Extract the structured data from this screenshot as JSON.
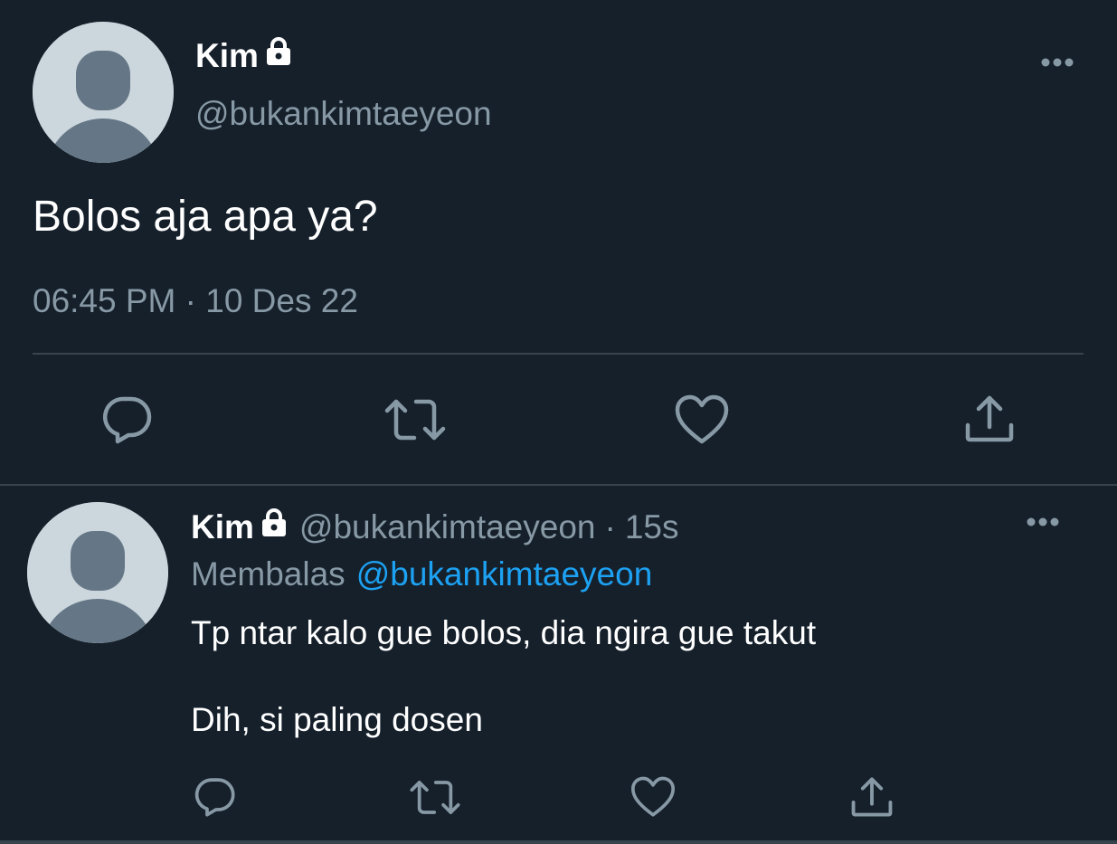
{
  "main_tweet": {
    "author_name": "Kim",
    "author_handle": "@bukankimtaeyeon",
    "text": "Bolos aja apa ya?",
    "meta": "06:45 PM · 10 Des 22",
    "protected_icon": "lock-icon",
    "more_icon": "more-horizontal-icon",
    "actions": [
      "reply-icon",
      "retweet-icon",
      "like-icon",
      "share-icon"
    ]
  },
  "reply_tweet": {
    "author_name": "Kim",
    "author_handle": "@bukankimtaeyeon",
    "separator": "·",
    "time": "15s",
    "replying_label": "Membalas",
    "replying_to": "@bukankimtaeyeon",
    "lines": [
      "Tp ntar kalo gue bolos, dia ngira gue takut",
      "Dih, si paling dosen"
    ],
    "protected_icon": "lock-icon",
    "more_icon": "more-horizontal-icon",
    "actions": [
      "reply-icon",
      "retweet-icon",
      "like-icon",
      "share-icon"
    ]
  },
  "colors": {
    "background": "#15202b",
    "primary_text": "#ffffff",
    "secondary_text": "#8899a6",
    "link": "#1da1f2",
    "divider": "#38444d",
    "avatar_bg": "#ccd6dd",
    "avatar_fg": "#657786"
  }
}
